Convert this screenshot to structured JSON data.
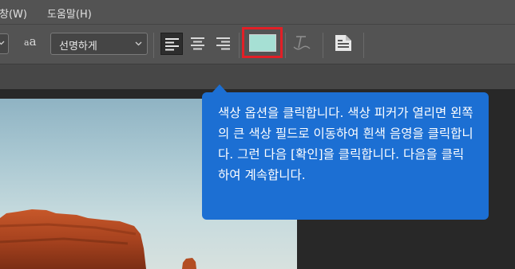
{
  "menubar": {
    "items": [
      "창(W)",
      "도움말(H)"
    ]
  },
  "options_bar": {
    "antialias_label": "a",
    "antialias_sub": "a",
    "antialias_value": "선명하게",
    "alignment": [
      "left",
      "center",
      "right"
    ],
    "active_alignment": "left",
    "text_color": "#a6e0d4",
    "highlight_color": "#e21f26",
    "icons": [
      "antialias-icon",
      "align-left-icon",
      "align-center-icon",
      "align-right-icon",
      "warp-text-icon",
      "character-panel-icon"
    ]
  },
  "tooltip": {
    "text": "색상 옵션을 클릭합니다. 색상 피커가 열리면 왼쪽의 큰 색상 필드로 이동하여 흰색 음영을 클릭합니다. 그런 다음 [확인]을 클릭합니다. 다음을 클릭하여 계속합니다.",
    "background": "#1c6fd3"
  }
}
